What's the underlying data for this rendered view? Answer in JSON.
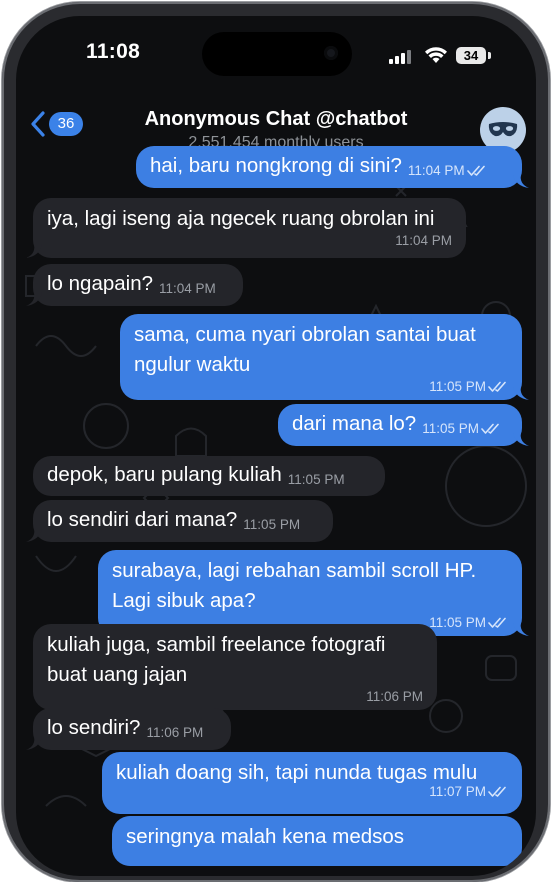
{
  "status_bar": {
    "time": "11:08",
    "battery": "34"
  },
  "header": {
    "back_count": "36",
    "title": "Anonymous Chat @chatbot",
    "subtitle": "2,551,454 monthly users",
    "avatar_icon": "mask-icon"
  },
  "colors": {
    "incoming_bubble": "#24252a",
    "outgoing_bubble": "#3d7fe3",
    "background": "#0d0e10",
    "accent": "#3b82e8"
  },
  "messages": [
    {
      "dir": "out",
      "text": "hai, baru nongkrong di sini?",
      "time": "11:04 PM",
      "read": true
    },
    {
      "dir": "in",
      "text": "iya, lagi iseng aja ngecek ruang obrolan ini",
      "time": "11:04 PM"
    },
    {
      "dir": "in",
      "text": "lo ngapain?",
      "time": "11:04 PM"
    },
    {
      "dir": "out",
      "text": "sama, cuma nyari obrolan santai buat ngulur waktu",
      "time": "11:05 PM",
      "read": true
    },
    {
      "dir": "out",
      "text": "dari mana lo?",
      "time": "11:05 PM",
      "read": true
    },
    {
      "dir": "in",
      "text": "depok, baru pulang kuliah",
      "time": "11:05 PM"
    },
    {
      "dir": "in",
      "text": "lo sendiri dari mana?",
      "time": "11:05 PM"
    },
    {
      "dir": "out",
      "text": "surabaya, lagi rebahan sambil scroll HP. Lagi sibuk apa?",
      "time": "11:05 PM",
      "read": true
    },
    {
      "dir": "in",
      "text": "kuliah juga, sambil freelance fotografi buat uang jajan",
      "time": "11:06 PM"
    },
    {
      "dir": "in",
      "text": "lo sendiri?",
      "time": "11:06 PM"
    },
    {
      "dir": "out",
      "text": "kuliah doang sih, tapi nunda tugas mulu",
      "time": "11:07 PM",
      "read": true
    },
    {
      "dir": "out",
      "text": "seringnya malah kena medsos",
      "time": ""
    }
  ]
}
